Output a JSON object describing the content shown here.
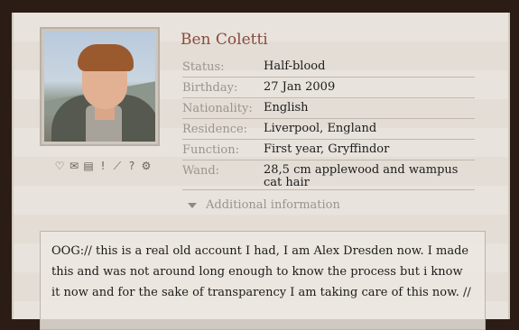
{
  "profile": {
    "name": "Ben Coletti",
    "fields": [
      {
        "label": "Status:",
        "value": "Half-blood"
      },
      {
        "label": "Birthday:",
        "value": "27 Jan 2009"
      },
      {
        "label": "Nationality:",
        "value": "English"
      },
      {
        "label": "Residence:",
        "value": "Liverpool, England"
      },
      {
        "label": "Function:",
        "value": "First year, Gryffindor"
      },
      {
        "label": "Wand:",
        "value": "28,5 cm applewood and wampus cat hair"
      }
    ],
    "additional_label": "Additional information",
    "ooc_text": "OOG:// this is a real old account I had, I am Alex Dresden now. I made this and was not around long enough to know the process but i know it now and for the sake of transparency I am taking care of this now. //"
  },
  "icons": [
    "heart-icon",
    "mail-icon",
    "list-icon",
    "exclamation-icon",
    "chart-icon",
    "question-icon",
    "gear-icon"
  ],
  "colors": {
    "name": "#8a4a3c",
    "label": "#9b948c"
  }
}
